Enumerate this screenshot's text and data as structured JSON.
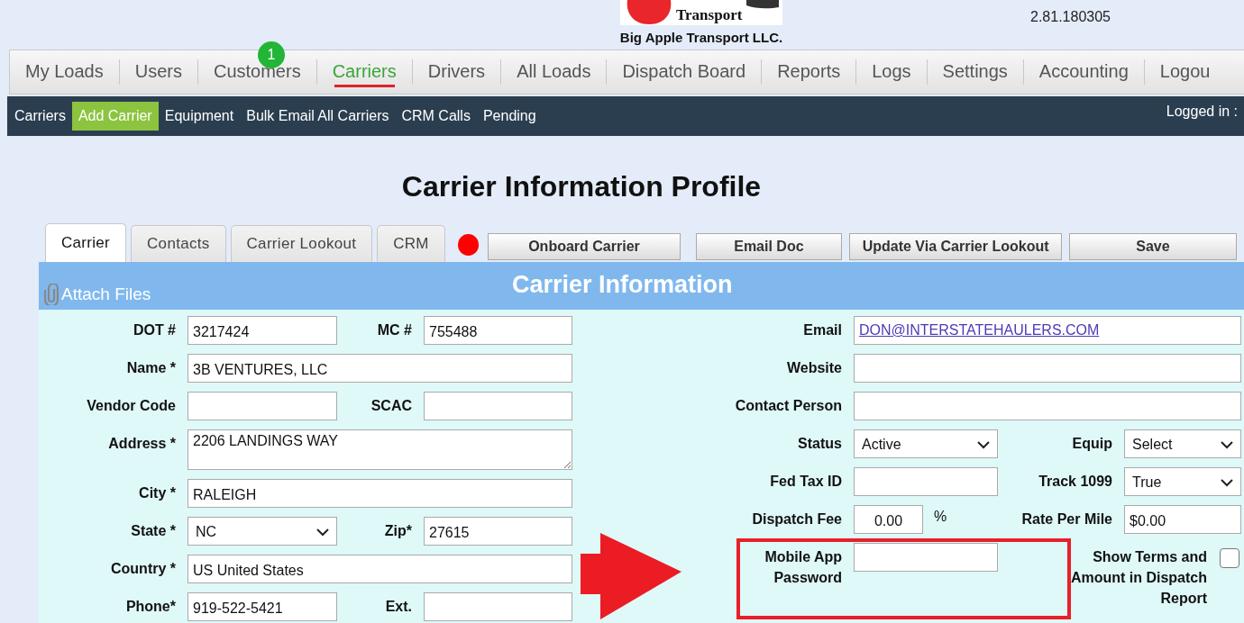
{
  "header": {
    "logo_text": "Transport",
    "company": "Big Apple Transport LLC.",
    "version": "2.81.180305"
  },
  "nav": [
    {
      "label": "My Loads",
      "selected": false
    },
    {
      "label": "Users",
      "selected": false
    },
    {
      "label": "Customers",
      "selected": false,
      "badge": "1"
    },
    {
      "label": "Carriers",
      "selected": true
    },
    {
      "label": "Drivers",
      "selected": false
    },
    {
      "label": "All Loads",
      "selected": false
    },
    {
      "label": "Dispatch Board",
      "selected": false
    },
    {
      "label": "Reports",
      "selected": false
    },
    {
      "label": "Logs",
      "selected": false
    },
    {
      "label": "Settings",
      "selected": false
    },
    {
      "label": "Accounting",
      "selected": false
    },
    {
      "label": "Logou",
      "selected": false
    }
  ],
  "subnav": {
    "items": [
      {
        "label": "Carriers",
        "selected": false
      },
      {
        "label": "Add Carrier",
        "selected": true
      },
      {
        "label": "Equipment",
        "selected": false
      },
      {
        "label": "Bulk Email All Carriers",
        "selected": false
      },
      {
        "label": "CRM Calls",
        "selected": false
      },
      {
        "label": "Pending",
        "selected": false
      }
    ],
    "logged_in": "Logged in :"
  },
  "page_title": "Carrier Information Profile",
  "tabs": [
    {
      "label": "Carrier",
      "selected": true
    },
    {
      "label": "Contacts",
      "selected": false
    },
    {
      "label": "Carrier Lookout",
      "selected": false
    },
    {
      "label": "CRM",
      "selected": false
    }
  ],
  "actions": [
    "Onboard Carrier",
    "Email Doc",
    "Update Via Carrier Lookout",
    "Save"
  ],
  "panel": {
    "attach_label": "Attach Files",
    "title": "Carrier Information"
  },
  "form": {
    "left": [
      [
        {
          "label": "DOT #",
          "value": "3217424",
          "kind": "text"
        },
        {
          "label": "MC #",
          "value": "755488",
          "kind": "text"
        }
      ],
      [
        {
          "label": "Name *",
          "value": "3B VENTURES, LLC",
          "kind": "text"
        }
      ],
      [
        {
          "label": "Vendor Code",
          "kind": "text"
        },
        {
          "label": "SCAC",
          "kind": "text"
        }
      ],
      [
        {
          "label": "Address *",
          "value": "2206 LANDINGS WAY",
          "kind": "textarea"
        }
      ],
      [
        {
          "label": "City *",
          "value": "RALEIGH",
          "kind": "text"
        }
      ],
      [
        {
          "label": "State *",
          "value": "NC",
          "kind": "select"
        },
        {
          "label": "Zip*",
          "value": "27615",
          "kind": "text"
        }
      ],
      [
        {
          "label": "Country *",
          "value": "US United States",
          "kind": "text"
        }
      ],
      [
        {
          "label": "Phone*",
          "value": "919-522-5421",
          "kind": "text"
        },
        {
          "label": "Ext.",
          "kind": "text"
        }
      ]
    ],
    "right": [
      [
        {
          "label": "Email",
          "value": "DON@INTERSTATEHAULERS.COM",
          "kind": "email"
        }
      ],
      [
        {
          "label": "Website",
          "kind": "text"
        }
      ],
      [
        {
          "label": "Contact Person",
          "kind": "text"
        }
      ],
      [
        {
          "label": "Status",
          "value": "Active",
          "kind": "select"
        },
        {
          "label": "Equip",
          "value": "Select",
          "kind": "select"
        }
      ],
      [
        {
          "label": "Fed Tax ID",
          "kind": "text"
        },
        {
          "label": "Track 1099",
          "value": "True",
          "kind": "select"
        }
      ],
      [
        {
          "label": "Dispatch Fee",
          "value": "0.00",
          "kind": "percent",
          "suffix": "%"
        },
        {
          "label": "Rate Per Mile",
          "value": "$0.00",
          "kind": "text"
        }
      ],
      [
        {
          "label": "Mobile App Password",
          "kind": "password"
        },
        {
          "label": "Show Terms and Amount in Dispatch Report",
          "kind": "checkbox",
          "checked": false
        }
      ]
    ]
  }
}
